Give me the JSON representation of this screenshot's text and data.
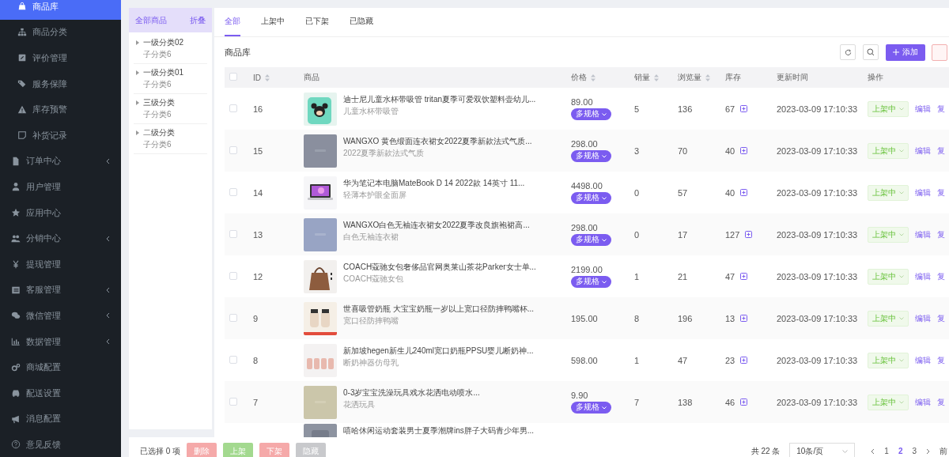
{
  "sidebar": {
    "submenu": [
      {
        "label": "商品库",
        "selected": true
      },
      {
        "label": "商品分类",
        "selected": false
      },
      {
        "label": "评价管理",
        "selected": false
      },
      {
        "label": "服务保障",
        "selected": false
      },
      {
        "label": "库存预警",
        "selected": false
      },
      {
        "label": "补货记录",
        "selected": false
      }
    ],
    "menu": [
      {
        "label": "订单中心",
        "has_submenu": true
      },
      {
        "label": "用户管理",
        "has_submenu": false
      },
      {
        "label": "应用中心",
        "has_submenu": false
      },
      {
        "label": "分销中心",
        "has_submenu": true
      },
      {
        "label": "提现管理",
        "has_submenu": false
      },
      {
        "label": "客服管理",
        "has_submenu": true
      },
      {
        "label": "微信管理",
        "has_submenu": true
      },
      {
        "label": "数据管理",
        "has_submenu": true
      },
      {
        "label": "商城配置",
        "has_submenu": false
      },
      {
        "label": "配送设置",
        "has_submenu": false
      },
      {
        "label": "消息配置",
        "has_submenu": false
      },
      {
        "label": "意见反馈",
        "has_submenu": false
      }
    ]
  },
  "categories": {
    "title": "全部商品",
    "collapse": "折叠",
    "items": [
      {
        "name": "一级分类02",
        "sub": "子分类6",
        "expanded": false
      },
      {
        "name": "一级分类01",
        "sub": "子分类6",
        "expanded": false
      },
      {
        "name": "三级分类",
        "sub": "子分类6",
        "expanded": false
      },
      {
        "name": "二级分类",
        "sub": "子分类6",
        "expanded": false
      }
    ]
  },
  "tabs": [
    {
      "label": "全部",
      "selected": true
    },
    {
      "label": "上架中",
      "selected": false
    },
    {
      "label": "已下架",
      "selected": false
    },
    {
      "label": "已隐藏",
      "selected": false
    }
  ],
  "panel_title": "商品库",
  "add_button": "添加",
  "table": {
    "header_checked": false,
    "columns": [
      {
        "label": "ID",
        "sortable": true
      },
      {
        "label": "商品",
        "sortable": false
      },
      {
        "label": "价格",
        "sortable": true
      },
      {
        "label": "销量",
        "sortable": true
      },
      {
        "label": "浏览量",
        "sortable": true
      },
      {
        "label": "库存",
        "sortable": false
      },
      {
        "label": "更新时间",
        "sortable": false
      },
      {
        "label": "操作",
        "sortable": false
      }
    ],
    "rows": [
      {
        "checked": false,
        "id": "16",
        "title": "迪士尼儿童水杯带吸管 tritan夏季可爱双饮塑料壶幼儿...",
        "subtitle": "儿童水杯带吸管",
        "price": "89.00",
        "spec_tag": "多规格",
        "sales": "5",
        "views": "136",
        "stock": "67",
        "updated": "2023-03-09 17:10:33",
        "status": "上架中",
        "edit": "编辑",
        "copy": "复"
      },
      {
        "checked": false,
        "id": "15",
        "title": "WANGXO 黄色缎面连衣裙女2022夏季新款法式气质...",
        "subtitle": "2022夏季新款法式气质",
        "price": "298.00",
        "spec_tag": "多规格",
        "sales": "3",
        "views": "70",
        "stock": "40",
        "updated": "2023-03-09 17:10:33",
        "status": "上架中",
        "edit": "编辑",
        "copy": "复"
      },
      {
        "checked": false,
        "id": "14",
        "title": "华为笔记本电脑MateBook D 14 2022款 14英寸 11...",
        "subtitle": "轻薄本护眼全面屏",
        "price": "4498.00",
        "spec_tag": "多规格",
        "sales": "0",
        "views": "57",
        "stock": "40",
        "updated": "2023-03-09 17:10:33",
        "status": "上架中",
        "edit": "编辑",
        "copy": "复"
      },
      {
        "checked": false,
        "id": "13",
        "title": "WANGXO白色无袖连衣裙女2022夏季改良旗袍裙高...",
        "subtitle": "白色无袖连衣裙",
        "price": "298.00",
        "spec_tag": "多规格",
        "sales": "0",
        "views": "17",
        "stock": "127",
        "updated": "2023-03-09 17:10:33",
        "status": "上架中",
        "edit": "编辑",
        "copy": "复"
      },
      {
        "checked": false,
        "id": "12",
        "title": "COACH蔻驰女包奢侈品官网奥莱山茶花Parker女士单...",
        "subtitle": "COACH蔻驰女包",
        "price": "2199.00",
        "spec_tag": "多规格",
        "sales": "1",
        "views": "21",
        "stock": "47",
        "updated": "2023-03-09 17:10:33",
        "status": "上架中",
        "edit": "编辑",
        "copy": "复"
      },
      {
        "checked": false,
        "id": "9",
        "title": "世喜吸管奶瓶 大宝宝奶瓶一岁以上宽口径防摔鸭嘴杯...",
        "subtitle": "宽口径防摔鸭嘴",
        "price": "195.00",
        "sales": "8",
        "views": "196",
        "stock": "13",
        "updated": "2023-03-09 17:10:33",
        "status": "上架中",
        "edit": "编辑",
        "copy": "复"
      },
      {
        "checked": false,
        "id": "8",
        "title": "新加坡hegen新生儿240ml宽口奶瓶PPSU婴儿断奶神...",
        "subtitle": "断奶神器仿母乳",
        "price": "598.00",
        "sales": "1",
        "views": "47",
        "stock": "23",
        "updated": "2023-03-09 17:10:33",
        "status": "上架中",
        "edit": "编辑",
        "copy": "复"
      },
      {
        "checked": false,
        "id": "7",
        "title": "0-3岁宝宝洗澡玩具戏水花洒电动喷水...",
        "subtitle": "花洒玩具",
        "price": "9.90",
        "spec_tag": "多规格",
        "sales": "7",
        "views": "138",
        "stock": "46",
        "updated": "2023-03-09 17:10:33",
        "status": "上架中",
        "edit": "编辑",
        "copy": "复"
      },
      {
        "title": "嘻哈休闲运动套装男士夏季潮牌ins胖子大码青少年男..."
      }
    ]
  },
  "footer": {
    "selected_count": "已选择 0 项",
    "buttons": [
      {
        "label": "删除",
        "kind": "danger"
      },
      {
        "label": "上架",
        "kind": "success"
      },
      {
        "label": "下架",
        "kind": "danger"
      },
      {
        "label": "隐藏",
        "kind": "muted"
      }
    ],
    "total": "共 22 条",
    "page_size": "10条/页",
    "pages": [
      {
        "label": "1",
        "selected": false
      },
      {
        "label": "2",
        "selected": true
      },
      {
        "label": "3",
        "selected": false
      }
    ],
    "goto": "前"
  }
}
